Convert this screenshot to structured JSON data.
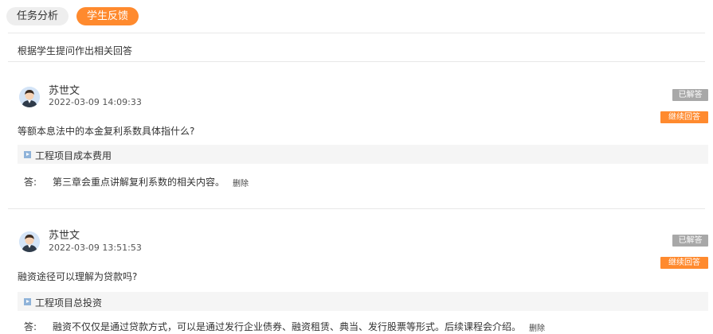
{
  "tabs": [
    {
      "label": "任务分析",
      "active": false
    },
    {
      "label": "学生反馈",
      "active": true
    }
  ],
  "subtitle": "根据学生提问作出相关回答",
  "feedback": [
    {
      "user": "苏世文",
      "time": "2022-03-09 14:09:33",
      "status": "已解答",
      "continue_label": "继续回答",
      "question": "等额本息法中的本金复利系数具体指什么?",
      "course": "工程项目成本费用",
      "answer_label": "答:",
      "answer": "第三章会重点讲解复利系数的相关内容。",
      "delete_label": "删除"
    },
    {
      "user": "苏世文",
      "time": "2022-03-09 13:51:53",
      "status": "已解答",
      "continue_label": "继续回答",
      "question": "融资途径可以理解为贷款吗?",
      "course": "工程项目总投资",
      "answer_label": "答:",
      "answer": "融资不仅仅是通过贷款方式，可以是通过发行企业债券、融资租赁、典当、发行股票等形式。后续课程会介绍。",
      "delete_label": "删除"
    }
  ],
  "colors": {
    "accent": "#ff8a2e",
    "badge_gray": "#a8a8a8",
    "course_icon": "#8fb3d9"
  },
  "icons": {
    "avatar": "user-avatar-icon",
    "course": "play-square-icon"
  }
}
